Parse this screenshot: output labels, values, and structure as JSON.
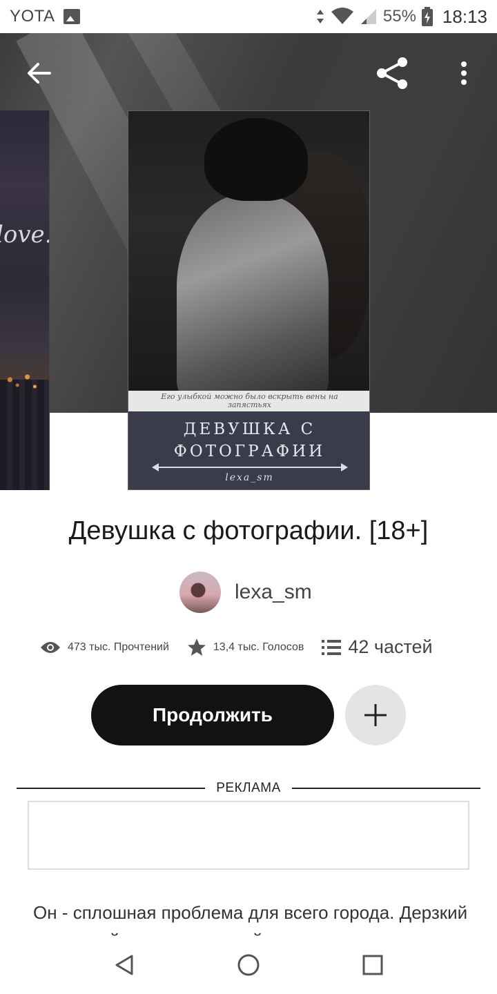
{
  "status_bar": {
    "carrier": "YOTA",
    "battery": "55%",
    "time": "18:13"
  },
  "story": {
    "cover_tagline": "Его улыбкой можно было вскрыть вены на запястьях",
    "cover_title": "ДЕВУШКА С ФОТОГРАФИИ",
    "cover_author": "lexa_sm",
    "side_cover_text": "love.",
    "title": "Девушка с фотографии. [18+]",
    "author": "lexa_sm",
    "stats": {
      "reads": "473 тыс. Прочтений",
      "votes": "13,4 тыс. Голосов",
      "parts": "42 частей"
    },
    "continue_label": "Продолжить",
    "description": "Он - сплошная проблема для всего города. Дерзкий и опасный, самодовольный парень"
  },
  "ad": {
    "label": "РЕКЛАМА"
  },
  "icons": {
    "back": "arrow-left-icon",
    "share": "share-icon",
    "more": "more-vertical-icon",
    "views": "eye-icon",
    "votes": "star-icon",
    "parts": "list-icon",
    "add": "plus-icon"
  }
}
